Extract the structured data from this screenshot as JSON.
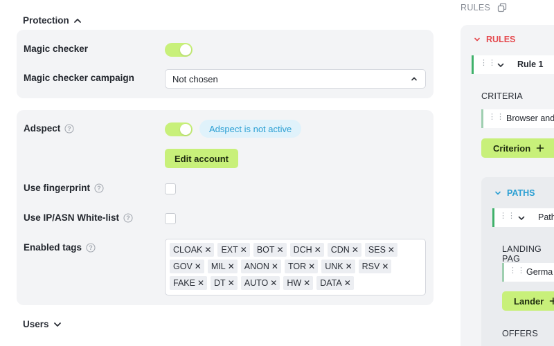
{
  "protection": {
    "title": "Protection",
    "magic_checker": {
      "label": "Magic checker",
      "enabled": true
    },
    "magic_checker_campaign": {
      "label": "Magic checker campaign",
      "value": "Not chosen"
    }
  },
  "adspect": {
    "label": "Adspect",
    "enabled": true,
    "status": "Adspect is not active",
    "edit_button": "Edit account",
    "use_fingerprint": {
      "label": "Use fingerprint",
      "checked": false
    },
    "use_ip_whitelist": {
      "label": "Use IP/ASN White-list",
      "checked": false
    },
    "enabled_tags": {
      "label": "Enabled tags",
      "tags": [
        "CLOAK",
        "EXT",
        "BOT",
        "DCH",
        "CDN",
        "SES",
        "GOV",
        "MIL",
        "ANON",
        "TOR",
        "UNK",
        "RSV",
        "FAKE",
        "DT",
        "AUTO",
        "HW",
        "DATA"
      ],
      "remove_glyph": "✕"
    }
  },
  "users": {
    "title": "Users"
  },
  "right_panel": {
    "title": "RULES",
    "rules_heading": "RULES",
    "rule_name": "Rule 1",
    "criteria_heading": "CRITERIA",
    "criteria_item": "Browser and",
    "criterion_button": "Criterion",
    "paths_heading": "PATHS",
    "path_name": "Path",
    "landing_heading": "LANDING PAG",
    "landing_item": "Germa",
    "lander_button": "Lander",
    "offers_heading": "OFFERS",
    "colors": {
      "rules_red": "#e5484d",
      "paths_blue": "#2b9fd3",
      "bar_green": "#3fb16a",
      "bar_light": "#9fcfb0",
      "accent_lime": "#c8f07a"
    }
  }
}
